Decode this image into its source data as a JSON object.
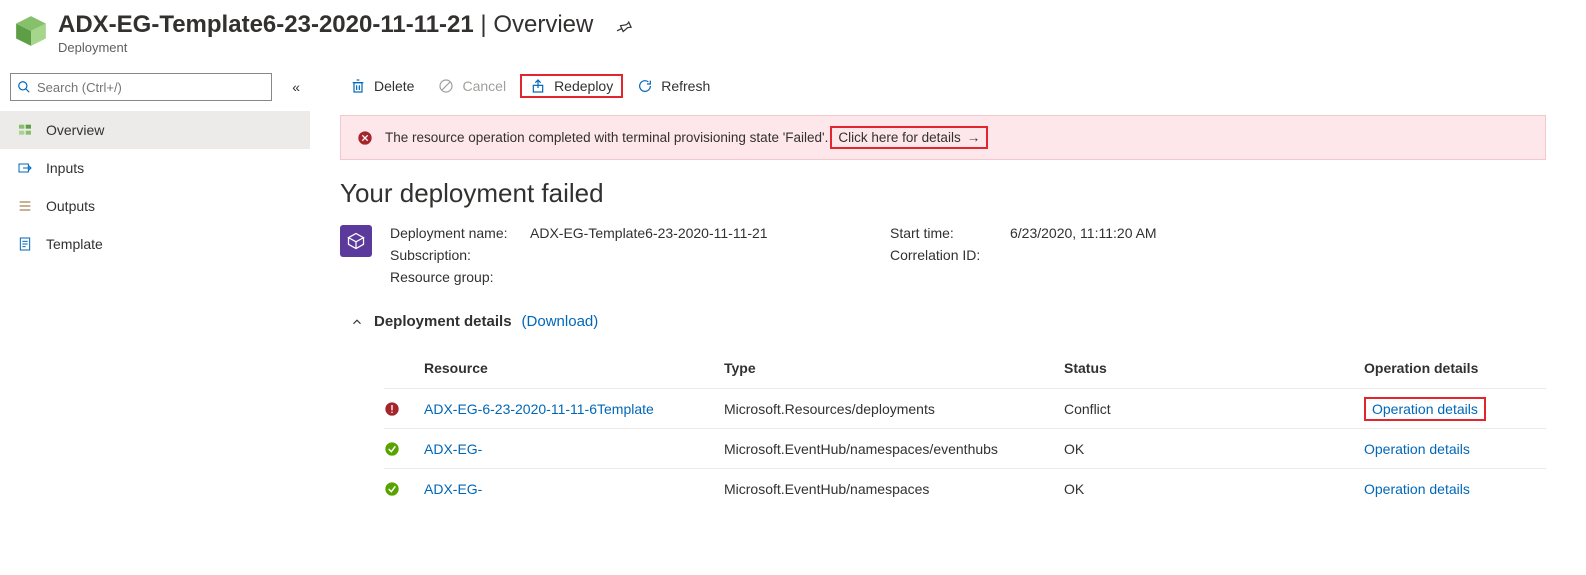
{
  "header": {
    "title_left": "ADX-EG-Template6-23-2020-11-11-21",
    "title_right": "Overview",
    "subtitle": "Deployment"
  },
  "search": {
    "placeholder": "Search (Ctrl+/)"
  },
  "sidebar": {
    "items": [
      {
        "label": "Overview"
      },
      {
        "label": "Inputs"
      },
      {
        "label": "Outputs"
      },
      {
        "label": "Template"
      }
    ]
  },
  "toolbar": {
    "delete": "Delete",
    "cancel": "Cancel",
    "redeploy": "Redeploy",
    "refresh": "Refresh"
  },
  "banner": {
    "message": "The resource operation completed with terminal provisioning state 'Failed'.",
    "link_text": "Click here for details"
  },
  "failure": {
    "heading": "Your deployment failed",
    "lbl_deployment_name": "Deployment name:",
    "deployment_name": "ADX-EG-Template6-23-2020-11-11-21",
    "lbl_subscription": "Subscription:",
    "subscription": "",
    "lbl_resource_group": "Resource group:",
    "resource_group": "",
    "lbl_start_time": "Start time:",
    "start_time": "6/23/2020, 11:11:20 AM",
    "lbl_correlation": "Correlation ID:",
    "correlation": ""
  },
  "details": {
    "header": "Deployment details",
    "download": "(Download)"
  },
  "table": {
    "cols": {
      "resource": "Resource",
      "type": "Type",
      "status": "Status",
      "op": "Operation details"
    },
    "rows": [
      {
        "state": "fail",
        "resource": "ADX-EG-6-23-2020-11-11-6Template",
        "type": "Microsoft.Resources/deployments",
        "status": "Conflict",
        "op": "Operation details",
        "hl": true
      },
      {
        "state": "ok",
        "resource": "ADX-EG-",
        "type": "Microsoft.EventHub/namespaces/eventhubs",
        "status": "OK",
        "op": "Operation details",
        "hl": false
      },
      {
        "state": "ok",
        "resource": "ADX-EG-",
        "type": "Microsoft.EventHub/namespaces",
        "status": "OK",
        "op": "Operation details",
        "hl": false
      }
    ]
  }
}
